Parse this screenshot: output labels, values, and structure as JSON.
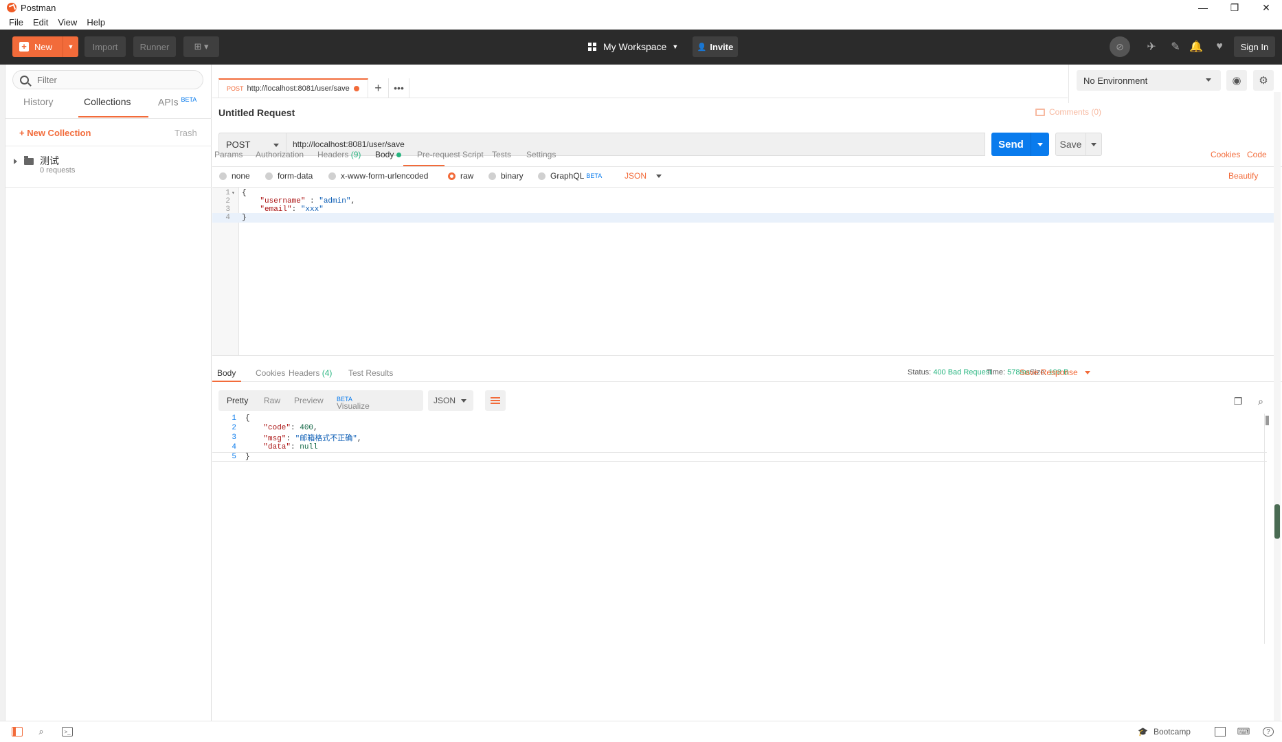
{
  "window": {
    "title": "Postman",
    "minimize": "—",
    "maximize": "❐",
    "close": "✕"
  },
  "menu": [
    "File",
    "Edit",
    "View",
    "Help"
  ],
  "header": {
    "new_label": "New",
    "import_label": "Import",
    "runner_label": "Runner",
    "workspace_label": "My Workspace",
    "invite_label": "Invite",
    "signin_label": "Sign In"
  },
  "sidebar": {
    "filter_placeholder": "Filter",
    "tabs": [
      {
        "label": "History"
      },
      {
        "label": "Collections"
      },
      {
        "label": "APIs",
        "badge": "BETA"
      }
    ],
    "new_collection_label": "New Collection",
    "trash_label": "Trash",
    "collections": [
      {
        "name": "测试",
        "count": "0 requests"
      }
    ]
  },
  "request_tab": {
    "method": "POST",
    "url": "http://localhost:8081/user/save"
  },
  "environment": {
    "selected": "No Environment"
  },
  "request": {
    "title": "Untitled Request",
    "comments_label": "Comments (0)",
    "method": "POST",
    "url": "http://localhost:8081/user/save",
    "send_label": "Send",
    "save_label": "Save"
  },
  "request_tabs": {
    "params": "Params",
    "authorization": "Authorization",
    "headers": "Headers",
    "headers_count": "(9)",
    "body": "Body",
    "prerequest": "Pre-request Script",
    "tests": "Tests",
    "settings": "Settings",
    "cookies": "Cookies",
    "code": "Code"
  },
  "body_types": {
    "none": "none",
    "form_data": "form-data",
    "urlencoded": "x-www-form-urlencoded",
    "raw": "raw",
    "binary": "binary",
    "graphql": "GraphQL",
    "graphql_badge": "BETA",
    "format": "JSON",
    "beautify": "Beautify"
  },
  "request_body_lines": [
    {
      "n": "1",
      "text": "{"
    },
    {
      "n": "2",
      "key": "\"username\"",
      "sep": " : ",
      "val": "\"admin\"",
      "tail": ","
    },
    {
      "n": "3",
      "key": "\"email\"",
      "sep": ": ",
      "val": "\"xxx\"",
      "tail": ""
    },
    {
      "n": "4",
      "text": "}"
    }
  ],
  "response_tabs": {
    "body": "Body",
    "cookies": "Cookies",
    "headers": "Headers",
    "headers_count": "(4)",
    "test_results": "Test Results"
  },
  "response_meta": {
    "status_label": "Status:",
    "status_value": "400 Bad Request",
    "time_label": "Time:",
    "time_value": "578ms",
    "size_label": "Size:",
    "size_value": "198 B",
    "save_response": "Save Response"
  },
  "response_view": {
    "pretty": "Pretty",
    "raw": "Raw",
    "preview": "Preview",
    "visualize": "Visualize",
    "visualize_badge": "BETA",
    "format": "JSON"
  },
  "response_body_lines": [
    {
      "n": "1",
      "text": "{"
    },
    {
      "n": "2",
      "key": "\"code\"",
      "val": "400",
      "tail": ",",
      "type": "num"
    },
    {
      "n": "3",
      "key": "\"msg\"",
      "val": "\"邮箱格式不正确\"",
      "tail": ",",
      "type": "str"
    },
    {
      "n": "4",
      "key": "\"data\"",
      "val": "null",
      "tail": "",
      "type": "num"
    },
    {
      "n": "5",
      "text": "}"
    }
  ],
  "footer": {
    "bootcamp_label": "Bootcamp"
  },
  "colors": {
    "accent": "#f26b3a",
    "primary": "#097bed",
    "success": "#26b47f",
    "header_bg": "#2b2b2b"
  },
  "icons": [
    "postman-logo-icon",
    "search-icon",
    "folder-icon",
    "grid-icon",
    "add-user-icon",
    "sync-icon",
    "satellite-icon",
    "wrench-icon",
    "bell-icon",
    "heart-icon",
    "eye-icon",
    "gear-icon",
    "comment-icon",
    "wrap-icon",
    "copy-icon",
    "sidebar-toggle-icon",
    "find-icon",
    "console-icon",
    "bootcamp-icon",
    "two-pane-icon",
    "keyboard-icon",
    "help-icon"
  ]
}
